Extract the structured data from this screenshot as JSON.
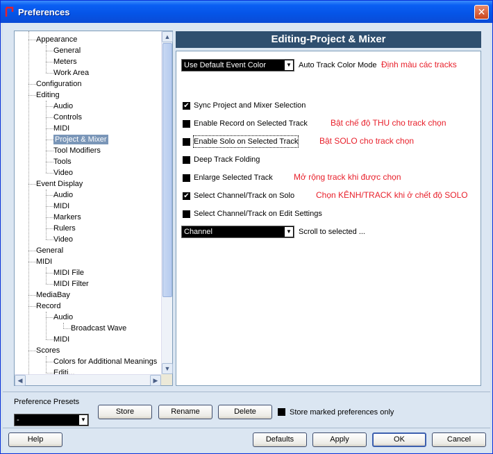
{
  "window": {
    "title": "Preferences",
    "close_label": "✕"
  },
  "tree": {
    "items": [
      {
        "label": "Appearance",
        "level": 1
      },
      {
        "label": "General",
        "level": 2
      },
      {
        "label": "Meters",
        "level": 2
      },
      {
        "label": "Work Area",
        "level": 2
      },
      {
        "label": "Configuration",
        "level": 1
      },
      {
        "label": "Editing",
        "level": 1
      },
      {
        "label": "Audio",
        "level": 2
      },
      {
        "label": "Controls",
        "level": 2
      },
      {
        "label": "MIDI",
        "level": 2
      },
      {
        "label": "Project & Mixer",
        "level": 2,
        "selected": true
      },
      {
        "label": "Tool Modifiers",
        "level": 2
      },
      {
        "label": "Tools",
        "level": 2
      },
      {
        "label": "Video",
        "level": 2
      },
      {
        "label": "Event Display",
        "level": 1
      },
      {
        "label": "Audio",
        "level": 2
      },
      {
        "label": "MIDI",
        "level": 2
      },
      {
        "label": "Markers",
        "level": 2
      },
      {
        "label": "Rulers",
        "level": 2
      },
      {
        "label": "Video",
        "level": 2
      },
      {
        "label": "General",
        "level": 1
      },
      {
        "label": "MIDI",
        "level": 1
      },
      {
        "label": "MIDI File",
        "level": 2
      },
      {
        "label": "MIDI Filter",
        "level": 2
      },
      {
        "label": "MediaBay",
        "level": 1
      },
      {
        "label": "Record",
        "level": 1
      },
      {
        "label": "Audio",
        "level": 2
      },
      {
        "label": "Broadcast Wave",
        "level": 3
      },
      {
        "label": "MIDI",
        "level": 2
      },
      {
        "label": "Scores",
        "level": 1
      },
      {
        "label": "Colors for Additional Meanings",
        "level": 2
      },
      {
        "label": "Editi...",
        "level": 2
      }
    ]
  },
  "panel": {
    "title": "Editing-Project & Mixer",
    "color_select": {
      "value": "Use Default Event Color",
      "label": "Auto Track Color Mode",
      "annotation": "Định màu các tracks"
    },
    "options": [
      {
        "label": "Sync Project and Mixer Selection",
        "checked": true,
        "annotation": ""
      },
      {
        "label": "Enable Record on Selected Track",
        "checked": false,
        "annotation": "Bật chế độ THU cho track chọn"
      },
      {
        "label": "Enable Solo on Selected Track",
        "checked": false,
        "annotation": "Bật SOLO cho track chọn",
        "focused": true
      },
      {
        "label": "Deep Track Folding",
        "checked": false,
        "annotation": ""
      },
      {
        "label": "Enlarge Selected Track",
        "checked": false,
        "annotation": "Mở rộng track khi được chọn"
      },
      {
        "label": "Select Channel/Track on Solo",
        "checked": true,
        "annotation": "Chọn KÊNH/TRACK khi ở chết độ SOLO"
      },
      {
        "label": "Select Channel/Track on Edit Settings",
        "checked": false,
        "annotation": ""
      }
    ],
    "scroll_select": {
      "value": "Channel",
      "label": "Scroll to selected ..."
    }
  },
  "presets": {
    "label": "Preference Presets",
    "value": "-",
    "store": "Store",
    "rename": "Rename",
    "delete": "Delete",
    "store_marked": "Store marked preferences only"
  },
  "footer": {
    "help": "Help",
    "defaults": "Defaults",
    "apply": "Apply",
    "ok": "OK",
    "cancel": "Cancel"
  },
  "colors": {
    "annotation": "#e8202b",
    "header_bg": "#2f4f6f",
    "selection": "#7a96b8"
  },
  "icons": {
    "check": "✔",
    "arrow_down": "▼",
    "arrow_up": "▲",
    "arrow_left": "◀",
    "arrow_right": "▶"
  }
}
